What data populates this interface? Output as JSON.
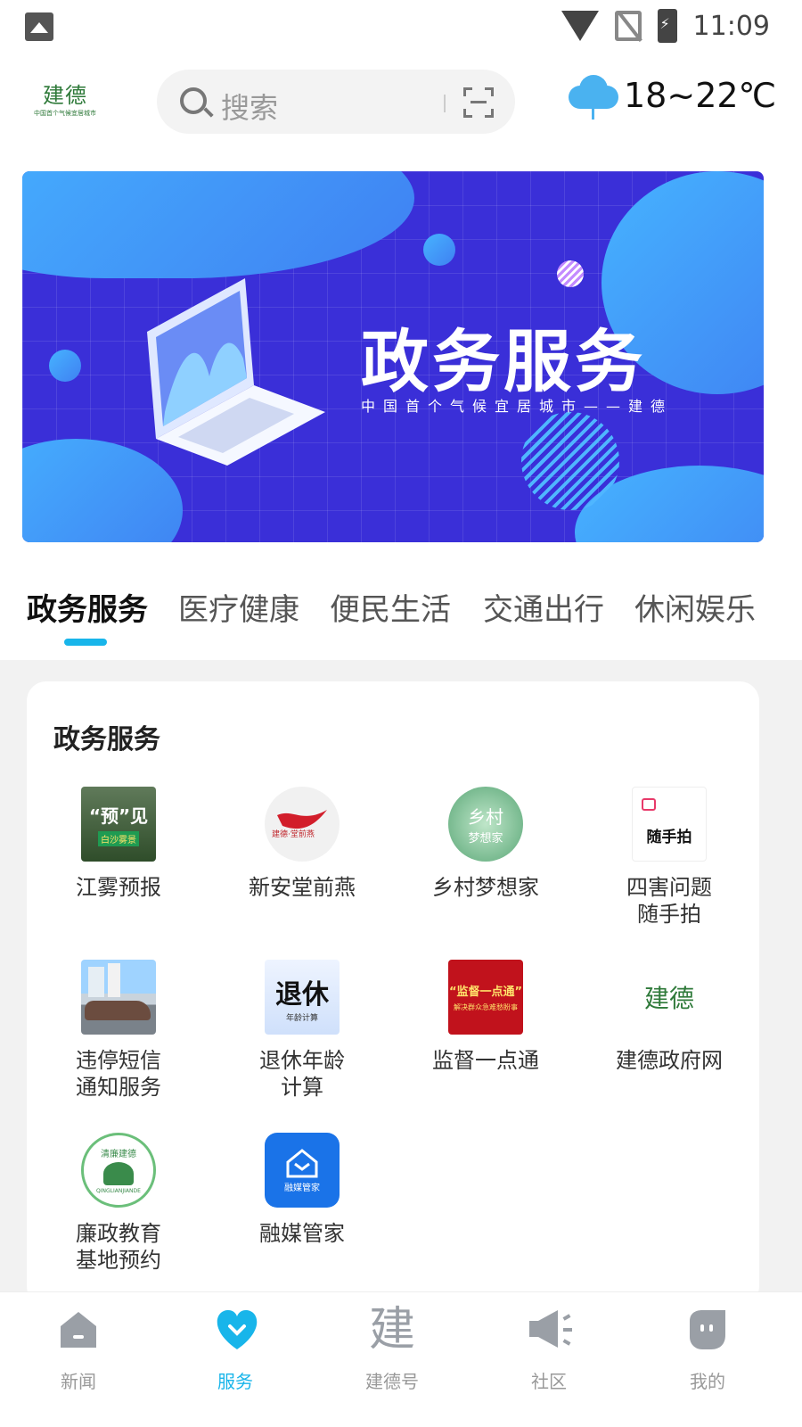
{
  "status": {
    "time": "11:09"
  },
  "header": {
    "logo_text": "建德",
    "logo_tagline": "中国首个气候宜居城市",
    "search_placeholder": "搜索",
    "weather_temp": "18~22℃"
  },
  "banner": {
    "title": "政务服务",
    "subtitle": "中国首个气候宜居城市——建德"
  },
  "tabs": [
    {
      "label": "政务服务",
      "active": true
    },
    {
      "label": "医疗健康",
      "active": false
    },
    {
      "label": "便民生活",
      "active": false
    },
    {
      "label": "交通出行",
      "active": false
    },
    {
      "label": "休闲娱乐",
      "active": false
    }
  ],
  "section": {
    "title": "政务服务",
    "items": [
      {
        "label": "江雾预报",
        "icon_text": "“预”见",
        "icon_sub": "白沙雾景"
      },
      {
        "label": "新安堂前燕",
        "icon_text": "建德·堂前燕"
      },
      {
        "label": "乡村梦想家",
        "icon_text": "乡村",
        "icon_sub": "梦想家"
      },
      {
        "label": "四害问题\n随手拍",
        "icon_text": "随手拍"
      },
      {
        "label": "违停短信\n通知服务"
      },
      {
        "label": "退休年龄\n计算",
        "icon_text": "退休",
        "icon_sub": "年龄计算"
      },
      {
        "label": "监督一点通",
        "icon_text": "“监督一点通”",
        "icon_sub": "解决群众急难愁盼事"
      },
      {
        "label": "建德政府网",
        "icon_text": "建德"
      },
      {
        "label": "廉政教育\n基地预约",
        "icon_text": "清廉建德",
        "icon_sub": "QINGLIANJIANDE"
      },
      {
        "label": "融媒管家",
        "icon_text": "融媒管家"
      }
    ]
  },
  "nav": [
    {
      "label": "新闻",
      "active": false
    },
    {
      "label": "服务",
      "active": true
    },
    {
      "label": "建德号",
      "active": false,
      "icon_text": "建"
    },
    {
      "label": "社区",
      "active": false
    },
    {
      "label": "我的",
      "active": false
    }
  ],
  "colors": {
    "accent": "#18b5ea",
    "banner_bg": "#3a2fd8"
  }
}
